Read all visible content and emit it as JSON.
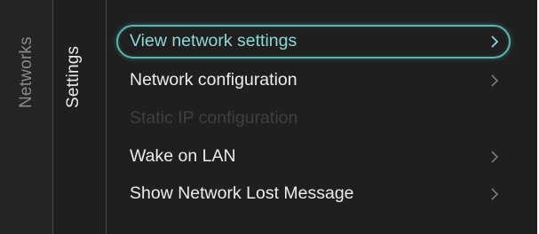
{
  "sidebar": {
    "networks_label": "Networks",
    "settings_label": "Settings"
  },
  "menu": {
    "items": [
      {
        "label": "View network settings",
        "state": "selected",
        "has_chevron": true
      },
      {
        "label": "Network configuration",
        "state": "normal",
        "has_chevron": true
      },
      {
        "label": "Static IP configuration",
        "state": "disabled",
        "has_chevron": false
      },
      {
        "label": "Wake on LAN",
        "state": "normal",
        "has_chevron": true
      },
      {
        "label": "Show Network Lost Message",
        "state": "normal",
        "has_chevron": true
      }
    ]
  },
  "colors": {
    "background": "#1f1f1f",
    "accent": "#58b8b0",
    "text": "#ececec",
    "disabled_text": "#3f3f3f",
    "inactive_column_text": "#8a8a8a"
  },
  "icons": {
    "chevron": "chevron-right-icon"
  }
}
